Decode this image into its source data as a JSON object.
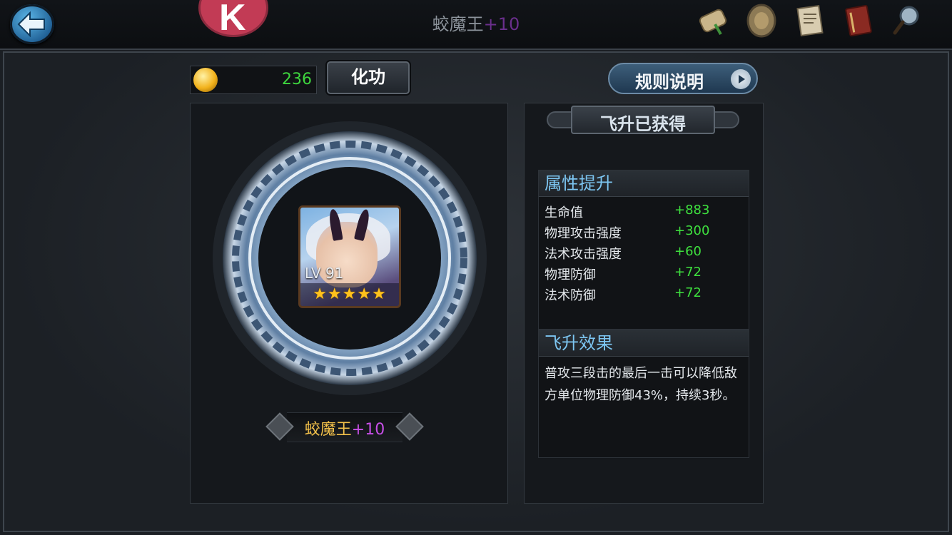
{
  "header": {
    "title_name": "蛟魔王",
    "title_level": "+10",
    "icons": [
      "scroll-icon",
      "shield-emblem-icon",
      "document-icon",
      "book-icon",
      "magnifier-icon"
    ]
  },
  "currency": {
    "value": "236",
    "icon": "gold-coin-icon"
  },
  "buttons": {
    "huagong": "化功",
    "rules": "规则说明"
  },
  "hero": {
    "level": "LV 91",
    "stars": "★★★★★",
    "star_count": 5,
    "name": "蛟魔王",
    "plus": "+10"
  },
  "status": "飞升已获得",
  "attributes": {
    "header": "属性提升",
    "rows": [
      {
        "name": "生命值",
        "value": "+883"
      },
      {
        "name": "物理攻击强度",
        "value": "+300"
      },
      {
        "name": "法术攻击强度",
        "value": "+60"
      },
      {
        "name": "物理防御",
        "value": "+72"
      },
      {
        "name": "法术防御",
        "value": "+72"
      }
    ]
  },
  "effect": {
    "header": "飞升效果",
    "text": "普攻三段击的最后一击可以降低敌方单位物理防御43%，持续3秒。"
  },
  "colors": {
    "accent_blue": "#7dc6f2",
    "gain_green": "#3ee03e",
    "name_gold": "#f2c04a",
    "plus_purple": "#c84fe8"
  }
}
